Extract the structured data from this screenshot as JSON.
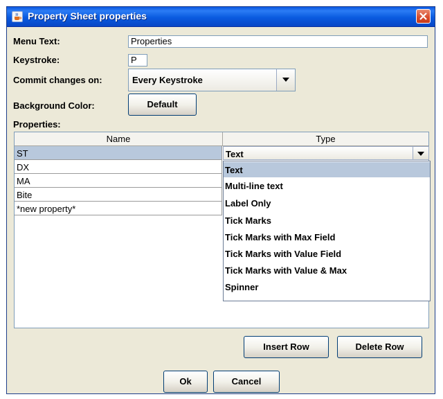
{
  "window": {
    "title": "Property Sheet properties"
  },
  "form": {
    "menu_text_label": "Menu Text:",
    "menu_text_value": "Properties",
    "keystroke_label": "Keystroke:",
    "keystroke_value": "P",
    "commit_label": "Commit changes on:",
    "commit_value": "Every Keystroke",
    "background_label": "Background Color:",
    "background_button": "Default",
    "properties_label": "Properties:"
  },
  "table": {
    "columns": [
      "Name",
      "Type"
    ],
    "rows": [
      {
        "name": "ST",
        "type": "Text"
      },
      {
        "name": "DX"
      },
      {
        "name": "MA"
      },
      {
        "name": "Bite"
      },
      {
        "name": "*new property*"
      }
    ]
  },
  "type_options": [
    "Text",
    "Multi-line text",
    "Label Only",
    "Tick Marks",
    "Tick Marks with Max Field",
    "Tick Marks with Value Field",
    "Tick Marks with Value & Max",
    "Spinner"
  ],
  "buttons": {
    "insert_row": "Insert Row",
    "delete_row": "Delete Row",
    "ok": "Ok",
    "cancel": "Cancel"
  },
  "colors": {
    "titlebar": "#0a57e0",
    "dialog_bg": "#ece9d8",
    "selection": "#b8c8dc",
    "close_button": "#d74a2a"
  }
}
